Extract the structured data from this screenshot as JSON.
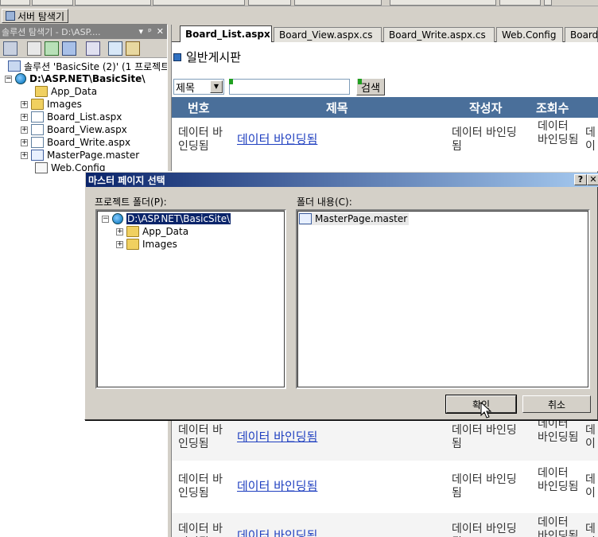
{
  "server_explorer": {
    "label": "서버 탐색기"
  },
  "solution_explorer": {
    "title": "솔루션 탐색기 - D:\\ASP....",
    "title_controls": [
      "▾",
      "ᵖ",
      "✕"
    ],
    "solution_label": "솔루션 'BasicSite (2)' (1 프로젝트)",
    "project_label": "D:\\ASP.NET\\BasicSite\\",
    "items": [
      {
        "label": "App_Data",
        "icon": "folder-icon"
      },
      {
        "label": "Images",
        "icon": "folder-icon"
      },
      {
        "label": "Board_List.aspx",
        "icon": "page-icon"
      },
      {
        "label": "Board_View.aspx",
        "icon": "page-icon"
      },
      {
        "label": "Board_Write.aspx",
        "icon": "page-icon"
      },
      {
        "label": "MasterPage.master",
        "icon": "master-page-icon"
      },
      {
        "label": "Web.Config",
        "icon": "config-icon"
      }
    ]
  },
  "doc_tabs": [
    {
      "label": "Board_List.aspx",
      "active": true
    },
    {
      "label": "Board_View.aspx.cs",
      "active": false
    },
    {
      "label": "Board_Write.aspx.cs",
      "active": false
    },
    {
      "label": "Web.Config",
      "active": false
    },
    {
      "label": "Board",
      "active": false
    }
  ],
  "board": {
    "title": "일반게시판",
    "search_select_value": "제목",
    "search_input_value": "",
    "search_button": "검색",
    "grid_headers": [
      "번호",
      "제목",
      "작성자",
      "조회수"
    ],
    "rows": [
      {
        "no": "데이터 바인딩됨",
        "title": "데이터 바인딩됨",
        "author": "데이터 바인딩됨",
        "views": "데이터 바인딩됨",
        "extra": "데이"
      },
      {
        "no": "데이터 바인딩됨",
        "title": "데이터 바인딩됨",
        "author": "데이터 바인딩됨",
        "views": "데이터 바인딩됨",
        "extra": "데이"
      },
      {
        "no": "데이터 바인딩됨",
        "title": "데이터 바인딩됨",
        "author": "데이터 바인딩됨",
        "views": "데이터 바인딩됨",
        "extra": "데이"
      },
      {
        "no": "데이터 바인딩됨",
        "title": "데이터 바인딩됨",
        "author": "데이터 바인딩됨",
        "views": "데이터 바인딩됨",
        "extra": "데이"
      }
    ]
  },
  "dialog": {
    "title": "마스터 페이지 선택",
    "help_button": "?",
    "close_button": "✕",
    "project_folder_label": "프로젝트 폴더(P):",
    "folder_contents_label": "폴더 내용(C):",
    "tree_root": "D:\\ASP.NET\\BasicSite\\",
    "tree_children": [
      "App_Data",
      "Images"
    ],
    "contents": [
      "MasterPage.master"
    ],
    "ok_button": "확인",
    "cancel_button": "취소"
  },
  "colors": {
    "grid_header_bg": "#4a6f9a",
    "dialog_title_start": "#0a246a",
    "dialog_title_end": "#a6caf0",
    "link_color": "#2040c0"
  }
}
